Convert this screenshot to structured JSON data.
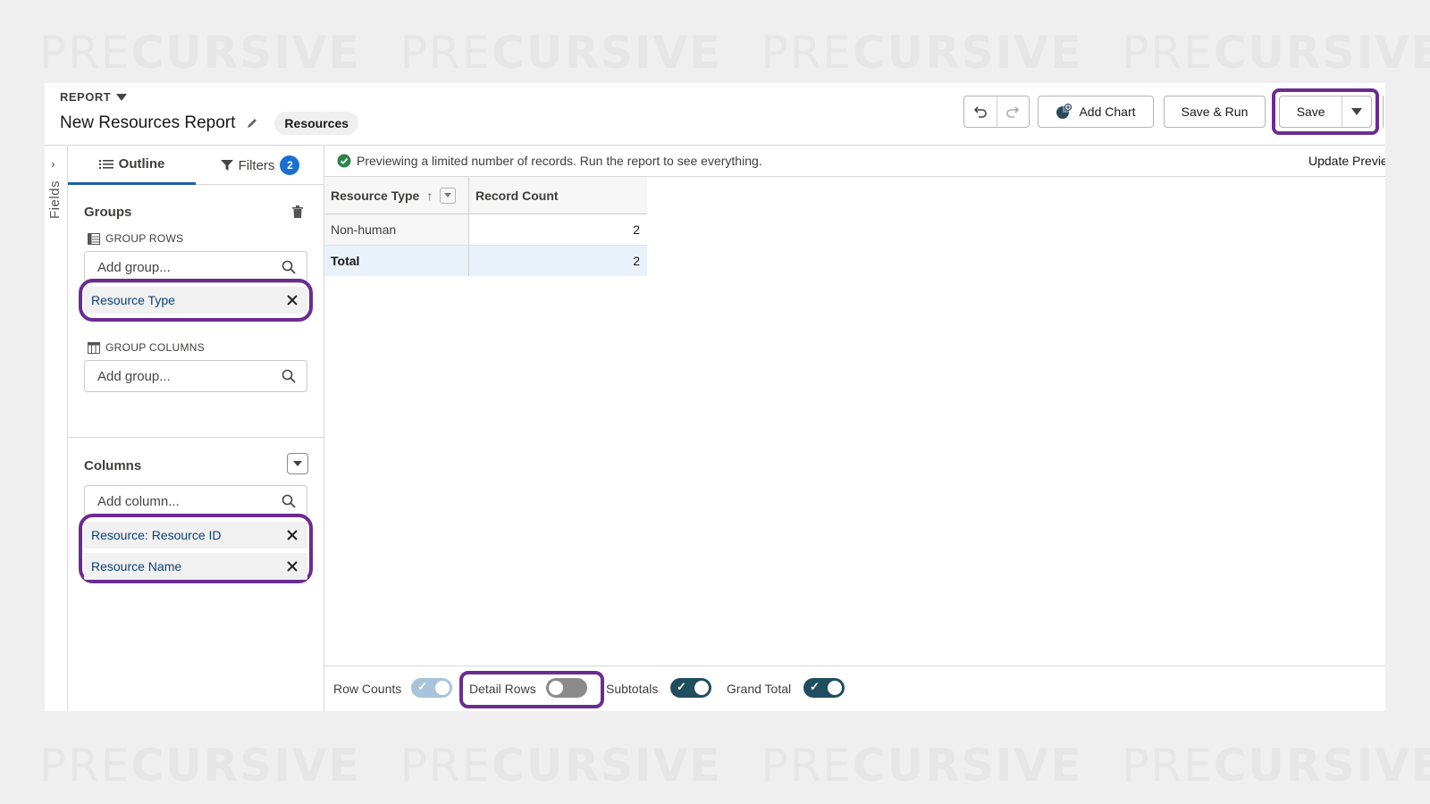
{
  "watermark": {
    "pre": "PRE",
    "bold": "CURSIVE"
  },
  "header": {
    "report_label": "REPORT",
    "title": "New Resources Report",
    "report_type": "Resources",
    "buttons": {
      "add_chart": "Add Chart",
      "save_run": "Save & Run",
      "save": "Save"
    }
  },
  "rail": {
    "label": "Fields"
  },
  "left_panel": {
    "tabs": {
      "outline": "Outline",
      "filters": "Filters",
      "filters_count": "2"
    },
    "groups": {
      "title": "Groups",
      "group_rows_label": "GROUP ROWS",
      "group_rows_placeholder": "Add group...",
      "group_rows_items": [
        "Resource Type"
      ],
      "group_columns_label": "GROUP COLUMNS",
      "group_columns_placeholder": "Add group..."
    },
    "columns": {
      "title": "Columns",
      "placeholder": "Add column...",
      "items": [
        "Resource: Resource ID",
        "Resource Name"
      ]
    }
  },
  "main": {
    "notice": "Previewing a limited number of records. Run the report to see everything.",
    "update_preview": "Update Preview",
    "table": {
      "headers": [
        "Resource Type",
        "Record Count"
      ],
      "rows": [
        {
          "resource_type": "Non-human",
          "record_count": "2"
        }
      ],
      "total_label": "Total",
      "total_value": "2"
    },
    "footer": {
      "row_counts": "Row Counts",
      "detail_rows": "Detail Rows",
      "subtotals": "Subtotals",
      "grand_total": "Grand Total",
      "row_counts_on": true,
      "detail_rows_on": false,
      "subtotals_on": true,
      "grand_total_on": true
    }
  },
  "colors": {
    "highlight": "#6b2c91",
    "tab_active": "#1b5fa8",
    "badge": "#1b6fd1",
    "toggle_on": "#1f4e5f",
    "toggle_faded": "#a9c4da",
    "toggle_off": "#8b8b8b",
    "success": "#2e844a"
  }
}
